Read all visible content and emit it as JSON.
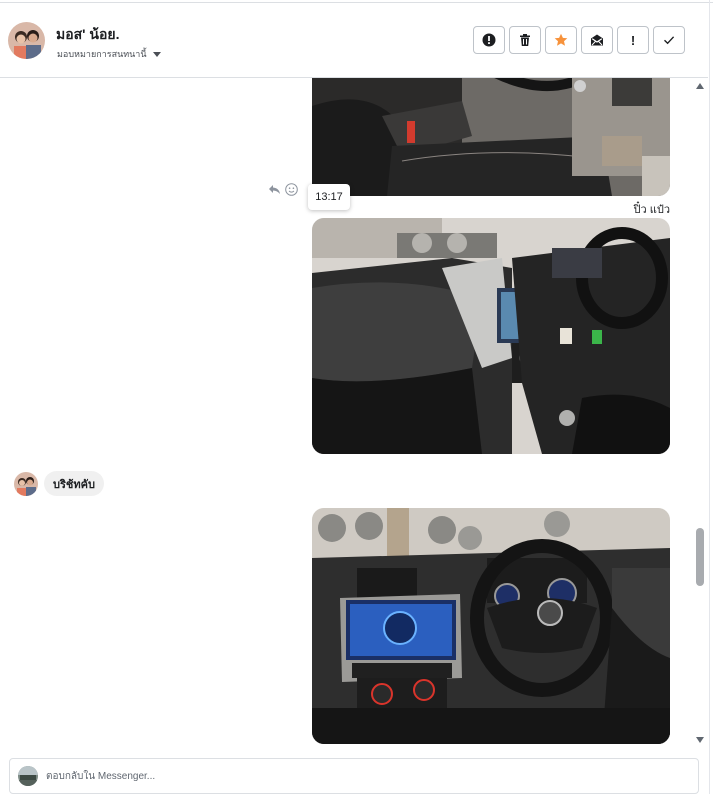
{
  "header": {
    "contact_name": "มอส' น้อย.",
    "assign_label": "มอบหมายการสนทนานี้",
    "actions": [
      {
        "icon": "alert-icon",
        "label": "Mark as spam"
      },
      {
        "icon": "trash-icon",
        "label": "Delete"
      },
      {
        "icon": "star-icon",
        "label": "Star",
        "color": "#f7923b"
      },
      {
        "icon": "mail-icon",
        "label": "Mark as unread"
      },
      {
        "icon": "exclamation-icon",
        "label": "Follow up",
        "glyph": "!"
      },
      {
        "icon": "check-icon",
        "label": "Mark as done"
      }
    ]
  },
  "chat": {
    "tooltip_time": "13:17",
    "sender_note": "ปิ๋ว แป๋ว",
    "incoming_text": "บริช้ทคับ"
  },
  "reply": {
    "placeholder": "ตอบกลับใน Messenger..."
  },
  "colors": {
    "star": "#f7923b",
    "border": "#bec3c9",
    "bubble": "#f0f0f0"
  }
}
